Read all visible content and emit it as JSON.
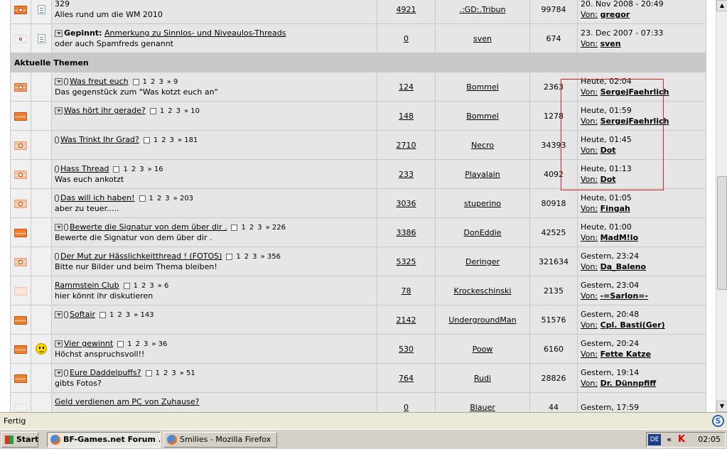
{
  "highlight_color": "#e02020",
  "top_rows": [
    {
      "icon": "env-new",
      "dot": true,
      "title": "",
      "has_title_link": false,
      "subtitle_top": "329",
      "subtitle": "Alles rund um die WM 2010",
      "replies": "4921",
      "author": ".:GD:.Tribun",
      "views": "99784",
      "last_date": "20. Nov 2008 - 20:49",
      "by_label": "Von:",
      "last_user": "gregor"
    },
    {
      "icon": "env-vfaded",
      "dot": true,
      "title": "Anmerkung zu Sinnlos- und Niveaulos-Threads",
      "prefix": "Gepinnt:",
      "subtitle": "oder auch Spamfreds genannt",
      "replies": "0",
      "author": "sven",
      "views": "674",
      "last_date": "23. Dec 2007 - 07:33",
      "by_label": "Von:",
      "last_user": "sven"
    }
  ],
  "section_title": "Aktuelle Themen",
  "topics": [
    {
      "icon": "env-hot",
      "dot": true,
      "sticky": true,
      "clip": true,
      "title": "Was freut euch",
      "pages": [
        "1",
        "2",
        "3",
        "» 9"
      ],
      "subtitle": "Das gegenstück zum \"Was kotzt euch an\"",
      "replies": "124",
      "author": "Bommel",
      "views": "2363",
      "last_date": "Heute, 02:04",
      "by_label": "Von:",
      "last_user": "SergejFaehrlich",
      "posticon": ""
    },
    {
      "icon": "env-new",
      "dot": false,
      "sticky": true,
      "clip": false,
      "title": "Was hört ihr gerade?",
      "pages": [
        "1",
        "2",
        "3",
        "» 10"
      ],
      "subtitle": "",
      "replies": "148",
      "author": "Bommel",
      "views": "1278",
      "last_date": "Heute, 01:59",
      "by_label": "Von:",
      "last_user": "SergejFaehrlich",
      "posticon": ""
    },
    {
      "icon": "env-light",
      "dot": true,
      "sticky": false,
      "clip": true,
      "title": "Was Trinkt Ihr Grad?",
      "pages": [
        "1",
        "2",
        "3",
        "» 181"
      ],
      "subtitle": "",
      "replies": "2710",
      "author": "Necro",
      "views": "34393",
      "last_date": "Heute, 01:45",
      "by_label": "Von:",
      "last_user": "Dot",
      "posticon": ""
    },
    {
      "icon": "env-light",
      "dot": true,
      "sticky": false,
      "clip": true,
      "title": "Hass Thread",
      "pages": [
        "1",
        "2",
        "3",
        "» 16"
      ],
      "subtitle": "Was euch ankotzt",
      "replies": "233",
      "author": "Playalain",
      "views": "4092",
      "last_date": "Heute, 01:13",
      "by_label": "Von:",
      "last_user": "Dot",
      "posticon": ""
    },
    {
      "icon": "env-light",
      "dot": true,
      "sticky": false,
      "clip": true,
      "title": "Das will ich haben!",
      "pages": [
        "1",
        "2",
        "3",
        "» 203"
      ],
      "subtitle": "aber zu teuer.....",
      "replies": "3036",
      "author": "stuperino",
      "views": "80918",
      "last_date": "Heute, 01:05",
      "by_label": "Von:",
      "last_user": "Fingah",
      "posticon": ""
    },
    {
      "icon": "env-new",
      "dot": false,
      "sticky": true,
      "clip": true,
      "title": "Bewerte die Signatur von dem über dir .",
      "pages": [
        "1",
        "2",
        "3",
        "» 226"
      ],
      "subtitle": "Bewerte die Signatur von dem über dir .",
      "replies": "3386",
      "author": "DonEddie",
      "views": "42525",
      "last_date": "Heute, 01:00",
      "by_label": "Von:",
      "last_user": "MadM!lo",
      "posticon": ""
    },
    {
      "icon": "env-light",
      "dot": true,
      "sticky": false,
      "clip": true,
      "title": "Der Mut zur Hässlichkeitthread ! (FOTOS)",
      "pages": [
        "1",
        "2",
        "3",
        "» 356"
      ],
      "subtitle": "Bitte nur Bilder und beim Thema bleiben!",
      "replies": "5325",
      "author": "Deringer",
      "views": "321634",
      "last_date": "Gestern, 23:24",
      "by_label": "Von:",
      "last_user": "Da_Baleno",
      "posticon": ""
    },
    {
      "icon": "env-faded",
      "dot": false,
      "sticky": false,
      "clip": false,
      "title": "Rammstein Club",
      "pages": [
        "1",
        "2",
        "3",
        "» 6"
      ],
      "subtitle": "hier könnt ihr diskutieren",
      "replies": "78",
      "author": "Krockeschinski",
      "views": "2135",
      "last_date": "Gestern, 23:04",
      "by_label": "Von:",
      "last_user": "-=Sarlon=-",
      "posticon": ""
    },
    {
      "icon": "env-new",
      "dot": false,
      "sticky": true,
      "clip": true,
      "title": "Softair",
      "pages": [
        "1",
        "2",
        "3",
        "» 143"
      ],
      "subtitle": "",
      "replies": "2142",
      "author": "UndergroundMan",
      "views": "51576",
      "last_date": "Gestern, 20:48",
      "by_label": "Von:",
      "last_user": "Cpl. Basti(Ger)",
      "posticon": ""
    },
    {
      "icon": "env-new",
      "dot": false,
      "sticky": true,
      "clip": false,
      "title": "Vier gewinnt",
      "pages": [
        "1",
        "2",
        "3",
        "» 36"
      ],
      "subtitle": "Höchst anspruchsvoll!!",
      "replies": "530",
      "author": "Poow",
      "views": "6160",
      "last_date": "Gestern, 20:24",
      "by_label": "Von:",
      "last_user": "Fette Katze",
      "posticon": "smiley"
    },
    {
      "icon": "env-new",
      "dot": false,
      "sticky": true,
      "clip": true,
      "title": "Eure Daddelpuffs?",
      "pages": [
        "1",
        "2",
        "3",
        "» 51"
      ],
      "subtitle": "gibts Fotos?",
      "replies": "764",
      "author": "Rudi",
      "views": "28826",
      "last_date": "Gestern, 19:14",
      "by_label": "Von:",
      "last_user": "Dr. Dünnpfiff",
      "posticon": ""
    },
    {
      "icon": "env-vfaded",
      "dot": false,
      "sticky": false,
      "clip": false,
      "title": "Geld verdienen am PC von Zuhause?",
      "pages": [],
      "subtitle": "",
      "replies": "0",
      "author": "Blauer",
      "views": "44",
      "last_date": "Gestern, 17:59",
      "by_label": "",
      "last_user": "",
      "posticon": ""
    }
  ],
  "statusbar": {
    "text": "Fertig"
  },
  "taskbar": {
    "start_label": "Start",
    "buttons": [
      {
        "label": "BF-Games.net Forum ...",
        "active": true
      },
      {
        "label": "Smilies - Mozilla Firefox",
        "active": false
      }
    ],
    "lang": "DE",
    "arrows": "«",
    "tray_k": "K",
    "clock": "02:05"
  }
}
